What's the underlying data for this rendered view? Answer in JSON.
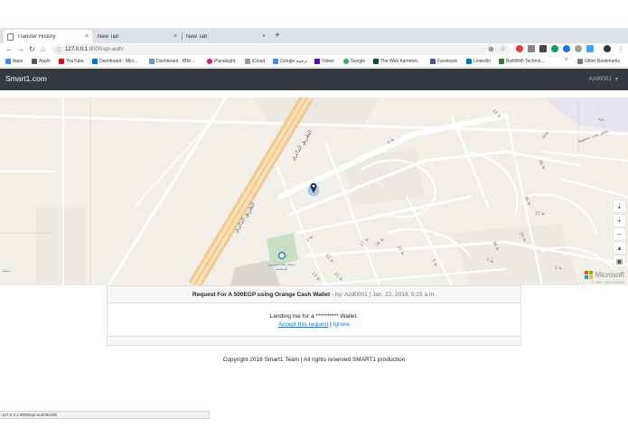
{
  "browser": {
    "tabs": [
      {
        "title": "Transfer History",
        "active": true
      },
      {
        "title": "New Tab",
        "active": false
      },
      {
        "title": "New Tab",
        "active": false
      }
    ],
    "new_tab_symbol": "+",
    "close_symbol": "×",
    "url_host": "127.0.0.1",
    "url_path": ":8000/api-auth/",
    "bookmarks": [
      {
        "label": "Apps",
        "color": "#4285f4"
      },
      {
        "label": "Apple",
        "color": "#555555"
      },
      {
        "label": "YouTube",
        "color": "#ff0000"
      },
      {
        "label": "Dashboard - Micr...",
        "color": "#0078d4"
      },
      {
        "label": "Dashboard - IBM ...",
        "color": "#5a9bd5"
      },
      {
        "label": "Pluralsight",
        "color": "#e80a89"
      },
      {
        "label": "iCloud",
        "color": "#999999"
      },
      {
        "label": "Google ترجمة",
        "color": "#4285f4"
      },
      {
        "label": "Yahoo",
        "color": "#5f01d1"
      },
      {
        "label": "Google",
        "color": "#34a853"
      },
      {
        "label": "The Web framewo...",
        "color": "#0c4b33"
      },
      {
        "label": "Facebook",
        "color": "#3b5998"
      },
      {
        "label": "LinkedIn",
        "color": "#0077b5"
      },
      {
        "label": "BuiltWith Technol...",
        "color": "#2e7d32"
      }
    ],
    "other_bookmarks": "Other Bookmarks",
    "status_url": "127.0.0.1:8000/api-auth/8/edit/"
  },
  "navbar": {
    "brand": "Smart1.com",
    "user": "Azd0001",
    "bg_color": "#343a40"
  },
  "map": {
    "place_label": "مسجد سادة الحرمين الإسلامية",
    "road_label_main": "الطريق الدائري",
    "brand": "Microsoft",
    "copyright": "© 1992 - 2018 TomTom"
  },
  "request_card": {
    "title": "Request For A 500EGP using Orange Cash Wallet",
    "meta": " - by: Azd0001 | Jan. 22, 2019, 5:25 a.m.",
    "body_text": "Lending me for a ********** Wallet.",
    "accept_label": "Accept this request",
    "separator": " | ",
    "ignore_label": "Ignore",
    "link_color": "#007bff"
  },
  "footer": {
    "copyright": "Copyright 2018 Smart1 Team | All rights reserved SMART1 production"
  }
}
